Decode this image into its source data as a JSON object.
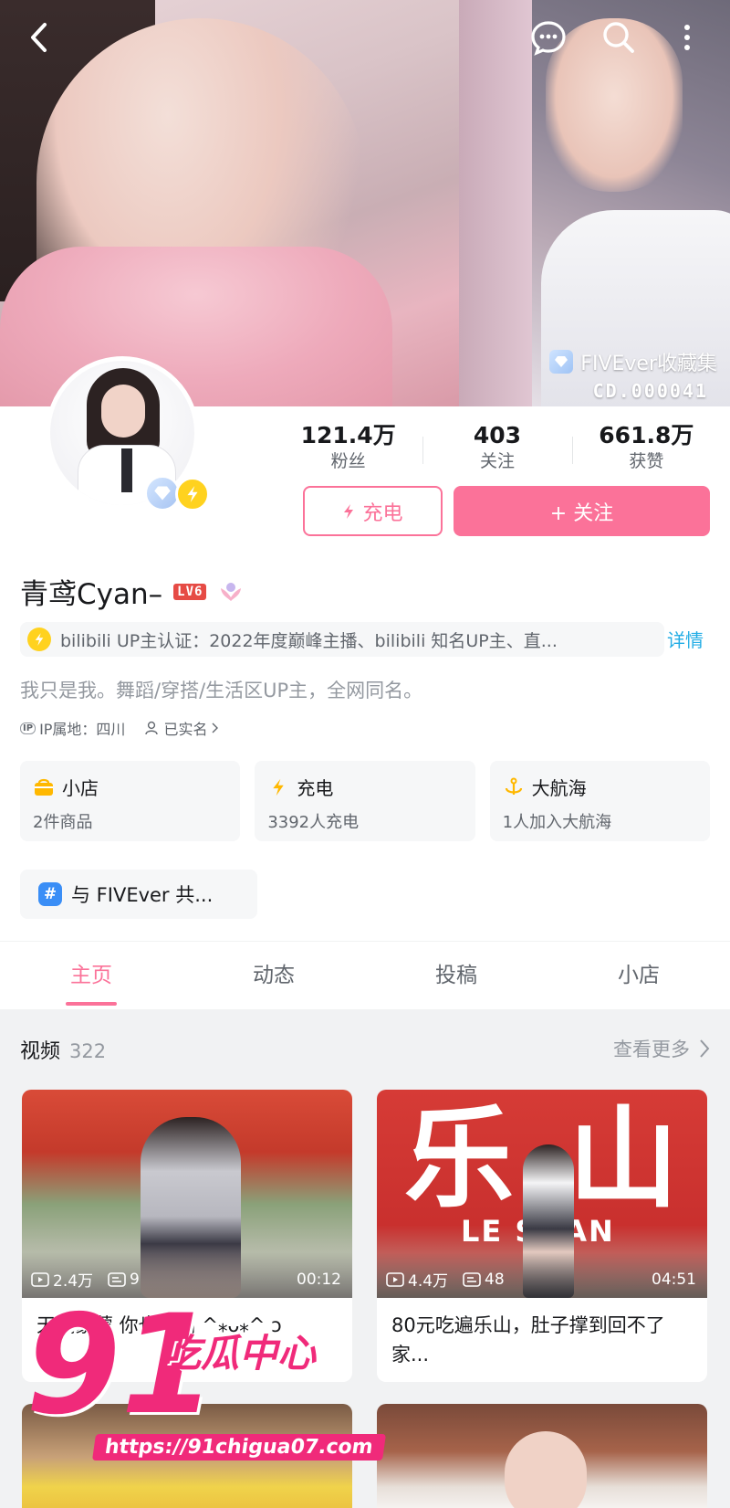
{
  "banner": {
    "collect_label": "FIVEver收藏集",
    "collect_code": "CD.000041"
  },
  "top_bar": {
    "back_icon": "back-arrow-icon",
    "chat_icon": "chat-bubble-icon",
    "search_icon": "search-icon",
    "more_icon": "more-vertical-icon"
  },
  "stats": [
    {
      "value": "121.4万",
      "label": "粉丝"
    },
    {
      "value": "403",
      "label": "关注"
    },
    {
      "value": "661.8万",
      "label": "获赞"
    }
  ],
  "actions": {
    "charge_label": "充电",
    "follow_label": "+ 关注"
  },
  "profile": {
    "name": "青鸢Cyan–",
    "level": "LV6",
    "certification": "bilibili UP主认证：2022年度巅峰主播、bilibili 知名UP主、直...",
    "cert_more": "详情",
    "bio": "我只是我。舞蹈/穿搭/生活区UP主，全网同名。",
    "ip": "IP属地：四川",
    "ip_tag": "IP",
    "verified": "已实名"
  },
  "cards": [
    {
      "title": "小店",
      "sub": "2件商品",
      "icon": "shop-icon",
      "color": "#ffb800"
    },
    {
      "title": "充电",
      "sub": "3392人充电",
      "icon": "lightning-icon",
      "color": "#ffb800"
    },
    {
      "title": "大航海",
      "sub": "1人加入大航海",
      "icon": "anchor-icon",
      "color": "#ffb800"
    }
  ],
  "topic": {
    "label": "与 FIVEver 共...",
    "icon_text": "#"
  },
  "tabs": [
    {
      "label": "主页",
      "active": true
    },
    {
      "label": "动态",
      "active": false
    },
    {
      "label": "投稿",
      "active": false
    },
    {
      "label": "小店",
      "active": false
    }
  ],
  "feed": {
    "title": "视频",
    "count": "322",
    "more": "查看更多",
    "videos": [
      {
        "views": "2.4万",
        "danmaku": "9",
        "duration": "00:12",
        "title": "天气蒙蒙 你也萌萌 ^⁎ᴗ⁎^ ↄ"
      },
      {
        "views": "4.4万",
        "danmaku": "48",
        "duration": "04:51",
        "title": "80元吃遍乐山，肚子撑到回不了家...",
        "thumb_big_left": "乐",
        "thumb_big_right": "山",
        "thumb_caption": "LE SHAN"
      }
    ]
  },
  "watermark": {
    "number": "91",
    "text": "吃瓜中心",
    "url": "https://91chigua07.com"
  },
  "colors": {
    "brand_pink": "#fb7299",
    "link_blue": "#23ade5",
    "gold": "#ffd21f"
  }
}
